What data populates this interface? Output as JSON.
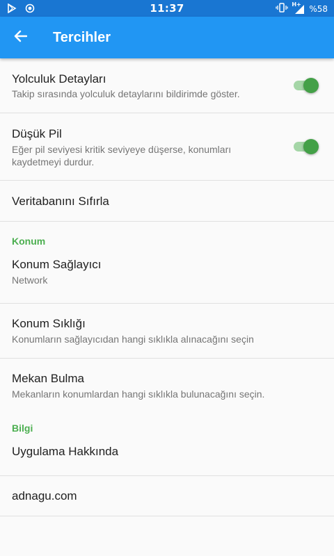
{
  "status_bar": {
    "time": "11:37",
    "battery_text": "%58",
    "network_type": "H+",
    "icons": [
      "play-store-icon",
      "record-icon",
      "vibrate-icon",
      "signal-icon",
      "battery-icon"
    ]
  },
  "app_bar": {
    "title": "Tercihler",
    "back_icon": "arrow-back-icon"
  },
  "preferences": {
    "trip_details": {
      "title": "Yolculuk Detayları",
      "summary": "Takip sırasında yolculuk detaylarını bildirimde göster.",
      "enabled": true
    },
    "low_battery": {
      "title": "Düşük Pil",
      "summary_line1": "Eğer pil seviyesi kritik seviyeye düşerse, konumları",
      "summary_line2": "kaydetmeyi durdur.",
      "enabled": true
    },
    "reset_database": {
      "title": "Veritabanını Sıfırla"
    },
    "location_category": {
      "title": "Konum"
    },
    "location_provider": {
      "title": "Konum Sağlayıcı",
      "summary": "Network"
    },
    "location_frequency": {
      "title": "Konum Sıklığı",
      "summary": "Konumların sağlayıcıdan hangi sıklıkla alınacağını seçin"
    },
    "place_finding": {
      "title": "Mekan Bulma",
      "summary": "Mekanların konumlardan hangi sıklıkla bulunacağını seçin."
    },
    "info_category": {
      "title": "Bilgi"
    },
    "about_app": {
      "title": "Uygulama Hakkında"
    },
    "website": {
      "title": "adnagu.com"
    }
  },
  "colors": {
    "status_bar": "#1976d2",
    "app_bar": "#2196f3",
    "accent": "#4caf50",
    "switch_thumb": "#43a047",
    "switch_track": "#a5d6a7",
    "background": "#fafafa"
  }
}
